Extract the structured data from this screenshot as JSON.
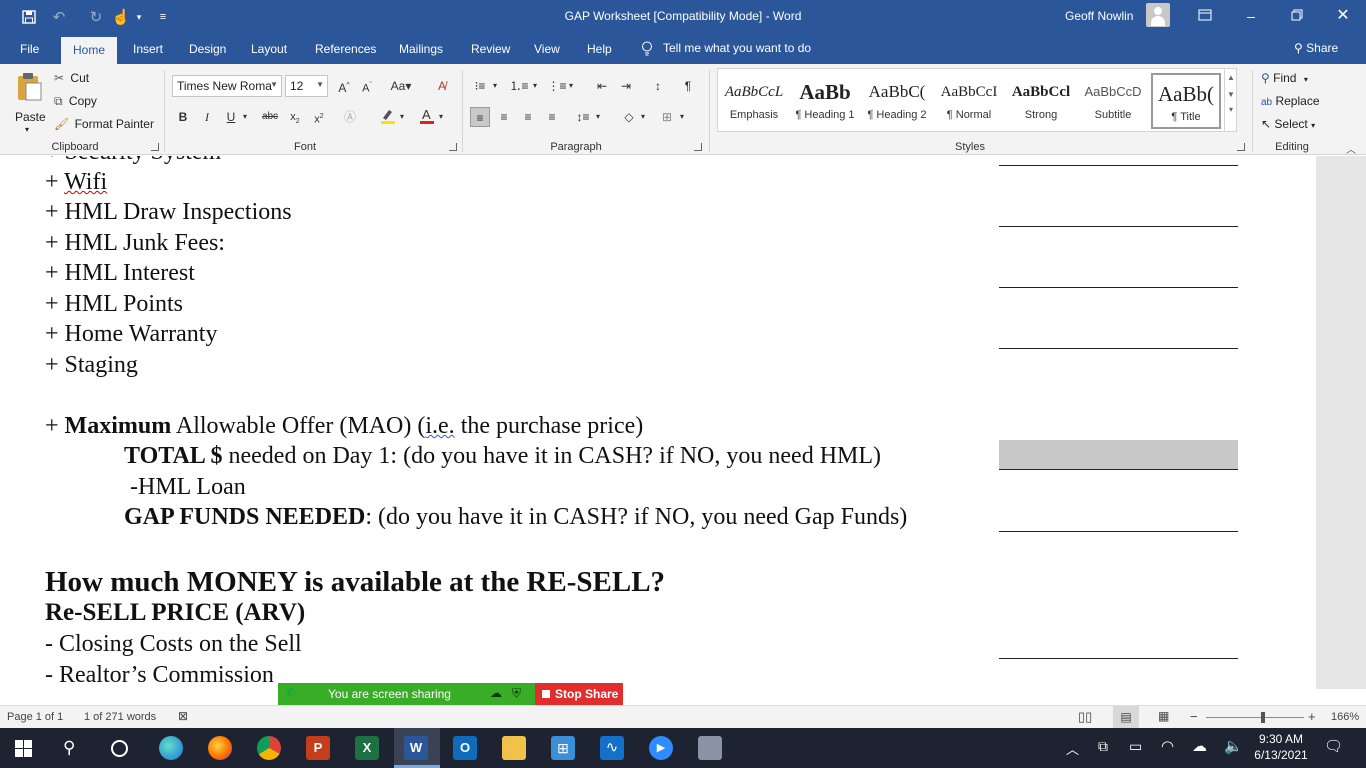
{
  "window": {
    "title": "GAP Worksheet [Compatibility Mode]  -  Word",
    "user": "Geoff Nowlin"
  },
  "tabs": [
    "File",
    "Home",
    "Insert",
    "Design",
    "Layout",
    "References",
    "Mailings",
    "Review",
    "View",
    "Help"
  ],
  "tell_me": "Tell me what you want to do",
  "share_label": "Share",
  "ribbon": {
    "clipboard": {
      "paste": "Paste",
      "cut": "Cut",
      "copy": "Copy",
      "format_painter": "Format Painter",
      "label": "Clipboard"
    },
    "font": {
      "name": "Times New Roma",
      "size": "12",
      "label": "Font"
    },
    "paragraph": {
      "label": "Paragraph"
    },
    "styles": {
      "label": "Styles",
      "items": [
        {
          "preview": "AaBbCcL",
          "name": "Emphasis"
        },
        {
          "preview": "AaBb",
          "name": "¶ Heading 1"
        },
        {
          "preview": "AaBbC(",
          "name": "¶ Heading 2"
        },
        {
          "preview": "AaBbCcI",
          "name": "¶ Normal"
        },
        {
          "preview": "AaBbCcl",
          "name": "Strong"
        },
        {
          "preview": "AaBbCcD",
          "name": "Subtitle"
        },
        {
          "preview": "AaBb(",
          "name": "¶ Title"
        }
      ]
    },
    "editing": {
      "find": "Find",
      "replace": "Replace",
      "select": "Select",
      "label": "Editing"
    }
  },
  "document": {
    "line_security": "+ Security System",
    "line_wifi_prefix": "+ ",
    "line_wifi_word": "Wifi",
    "line_draw": "+ HML Draw Inspections",
    "line_junk": "+ HML Junk Fees:",
    "line_interest": "+ HML Interest",
    "line_points": "+ HML Points",
    "line_warranty": "+ Home Warranty",
    "line_staging": "+ Staging",
    "mao_prefix": "+ ",
    "mao_bold": "Maximum",
    "mao_rest1": " Allowable Offer (MAO) (",
    "mao_ie": "i.e.",
    "mao_rest2": " the purchase price)",
    "total_bold": "TOTAL $",
    "total_rest": " needed on Day 1: (do you have it in CASH? if NO, you need HML)",
    "hml_loan": "-HML Loan",
    "gap_bold": "GAP FUNDS NEEDED",
    "gap_rest": ": (do you have it in CASH? if NO, you need Gap Funds)",
    "heading_money": "How much MONEY is available at the RE-SELL?",
    "heading_resell": "Re-SELL PRICE (ARV)",
    "line_closing": "- Closing Costs on the Sell",
    "line_realtor": "- Realtor’s Commission"
  },
  "screen_share": {
    "status": "You are screen sharing",
    "stop": "Stop Share"
  },
  "status_bar": {
    "page": "Page 1 of 1",
    "words": "1 of 271 words",
    "zoom": "166%"
  },
  "taskbar": {
    "time": "9:30 AM",
    "date": "6/13/2021"
  },
  "colors": {
    "word_blue": "#2b579a",
    "share_green": "#3aad28",
    "stop_red": "#e02e2e",
    "taskbar": "#1d2330"
  }
}
